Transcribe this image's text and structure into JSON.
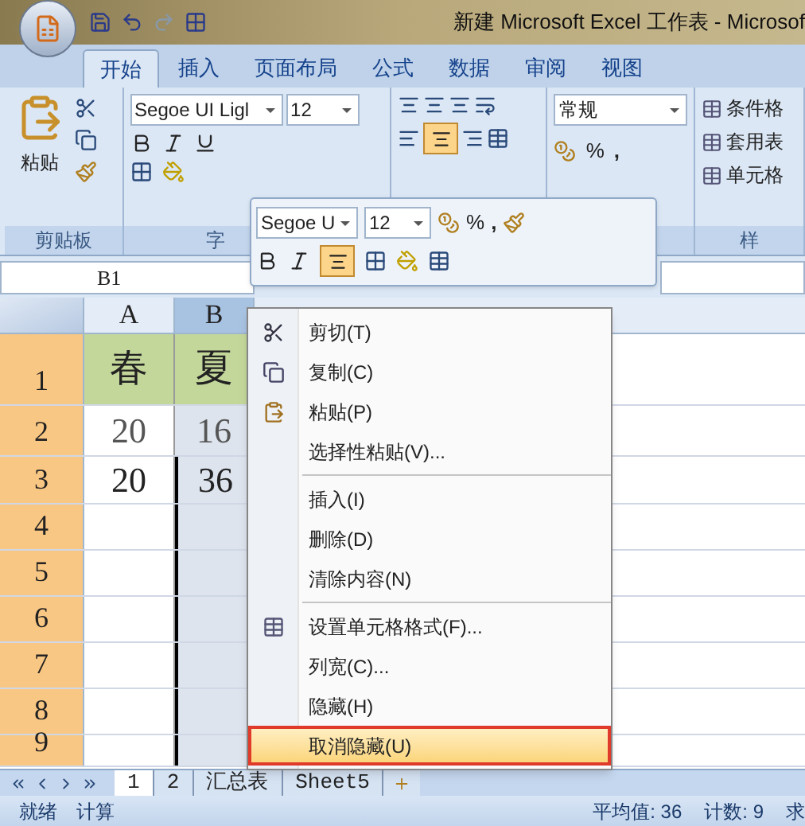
{
  "window": {
    "title": "新建 Microsoft Excel 工作表 - Microsof"
  },
  "ribbon_tabs": [
    {
      "label": "开始",
      "selected": true
    },
    {
      "label": "插入",
      "selected": false
    },
    {
      "label": "页面布局",
      "selected": false
    },
    {
      "label": "公式",
      "selected": false
    },
    {
      "label": "数据",
      "selected": false
    },
    {
      "label": "审阅",
      "selected": false
    },
    {
      "label": "视图",
      "selected": false
    }
  ],
  "clipboard": {
    "paste": "粘贴",
    "label": "剪贴板"
  },
  "font_group": {
    "font_name": "Segoe UI Ligl",
    "font_size": "12",
    "label": "字"
  },
  "alignment_group": {
    "center_selected": true
  },
  "number_group": {
    "format": "常规",
    "percent": "%",
    "comma": ","
  },
  "styles_group": {
    "items": [
      "条件格",
      "套用表",
      "单元格"
    ],
    "label": "样"
  },
  "name_box": "B1",
  "mini_toolbar": {
    "font_name": "Segoe U",
    "font_size": "12",
    "percent": "%",
    "comma": ",",
    "center_selected": true
  },
  "sheet": {
    "columns": [
      {
        "label": "A",
        "selected": false
      },
      {
        "label": "B",
        "selected": true
      }
    ],
    "rows": [
      {
        "label": "1",
        "cells": [
          "春",
          "夏"
        ]
      },
      {
        "label": "2",
        "cells": [
          "20",
          "16"
        ]
      },
      {
        "label": "3",
        "cells": [
          "20",
          "36"
        ]
      },
      {
        "label": "4",
        "cells": []
      },
      {
        "label": "5",
        "cells": []
      },
      {
        "label": "6",
        "cells": []
      },
      {
        "label": "7",
        "cells": []
      },
      {
        "label": "8",
        "cells": []
      },
      {
        "label": "9",
        "cells": []
      }
    ]
  },
  "context_menu": [
    {
      "kind": "cut",
      "label": "剪切(T)",
      "selected": false
    },
    {
      "kind": "copy",
      "label": "复制(C)",
      "selected": false
    },
    {
      "kind": "paste",
      "label": "粘贴(P)",
      "selected": false
    },
    {
      "kind": "item",
      "label": "选择性粘贴(V)...",
      "selected": false
    },
    {
      "kind": "separator"
    },
    {
      "kind": "item",
      "label": "插入(I)",
      "selected": false
    },
    {
      "kind": "item",
      "label": "删除(D)",
      "selected": false
    },
    {
      "kind": "item",
      "label": "清除内容(N)",
      "selected": false
    },
    {
      "kind": "separator"
    },
    {
      "kind": "format",
      "label": "设置单元格格式(F)...",
      "selected": false
    },
    {
      "kind": "item",
      "label": "列宽(C)...",
      "selected": false
    },
    {
      "kind": "item",
      "label": "隐藏(H)",
      "selected": false
    },
    {
      "kind": "item",
      "label": "取消隐藏(U)",
      "selected": true
    }
  ],
  "sheet_tabs": [
    {
      "label": "1",
      "selected": true
    },
    {
      "label": "2",
      "selected": false
    },
    {
      "label": "汇总表",
      "selected": false
    },
    {
      "label": "Sheet5",
      "selected": false
    }
  ],
  "status_bar": {
    "left": [
      "就绪",
      "计算"
    ],
    "right": [
      "平均值: 36",
      "计数: 9",
      "求"
    ]
  }
}
